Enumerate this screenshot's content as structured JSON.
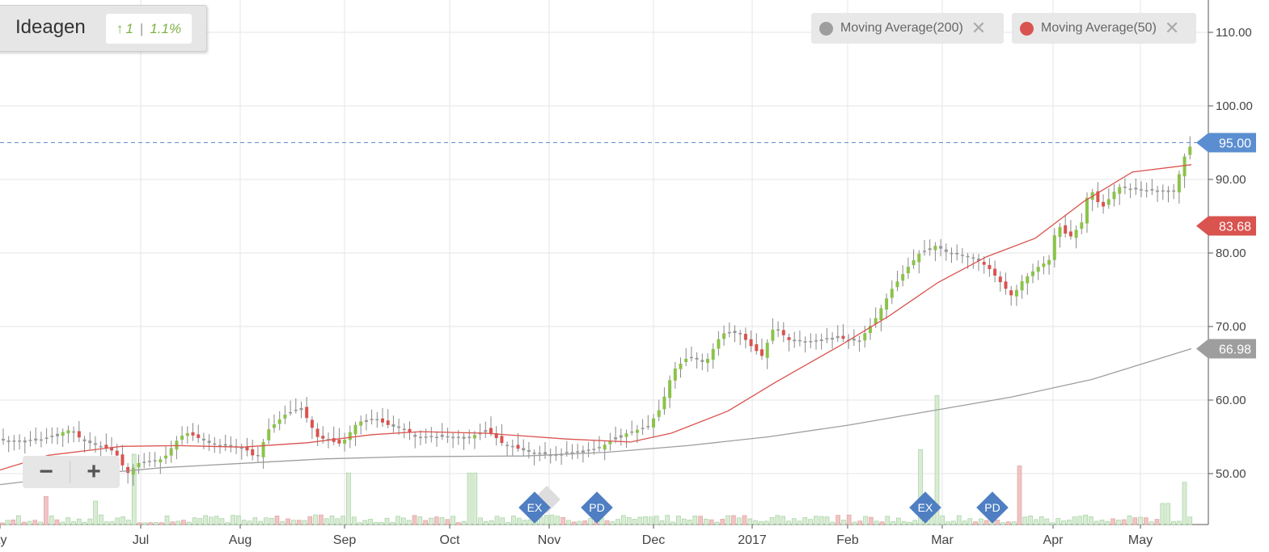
{
  "title": {
    "name": "Ideagen",
    "change_value": "1",
    "change_pct": "1.1%",
    "direction": "up"
  },
  "legend": [
    {
      "label": "Moving Average(200)",
      "color": "#9e9e9e"
    },
    {
      "label": "Moving Average(50)",
      "color": "#d9534f"
    }
  ],
  "zoom": {
    "minus": "−",
    "plus": "+"
  },
  "chart_data": {
    "type": "candlestick",
    "y_axis": {
      "min": 43,
      "max": 115,
      "ticks": [
        "50.00",
        "60.00",
        "70.00",
        "80.00",
        "90.00",
        "100.00",
        "110.00"
      ],
      "position": "right"
    },
    "x_axis": {
      "labels": [
        "ay",
        "Jul",
        "Aug",
        "Sep",
        "Oct",
        "Nov",
        "Dec",
        "2017",
        "Feb",
        "Mar",
        "Apr",
        "May"
      ]
    },
    "grid": true,
    "current_price": {
      "value": 95.0,
      "label": "95.00",
      "color": "#5b8ed0"
    },
    "series_labels": [
      {
        "name": "Moving Average(50)",
        "value": 83.68,
        "label": "83.68",
        "color": "#d9534f"
      },
      {
        "name": "Moving Average(200)",
        "value": 66.98,
        "label": "66.98",
        "color": "#9e9e9e"
      }
    ],
    "price_anchors": [
      [
        0,
        54.5
      ],
      [
        45,
        54.5
      ],
      [
        85,
        56
      ],
      [
        100,
        54.5
      ],
      [
        140,
        53
      ],
      [
        155,
        50
      ],
      [
        170,
        51.5
      ],
      [
        200,
        52
      ],
      [
        220,
        55
      ],
      [
        230,
        55.5
      ],
      [
        260,
        54
      ],
      [
        300,
        53.5
      ],
      [
        315,
        52
      ],
      [
        330,
        56
      ],
      [
        350,
        58
      ],
      [
        370,
        59
      ],
      [
        390,
        55
      ],
      [
        420,
        54
      ],
      [
        440,
        57
      ],
      [
        460,
        57.5
      ],
      [
        480,
        56.5
      ],
      [
        500,
        56
      ],
      [
        510,
        55
      ],
      [
        550,
        55
      ],
      [
        580,
        55
      ],
      [
        600,
        56
      ],
      [
        620,
        54
      ],
      [
        650,
        53
      ],
      [
        680,
        52.5
      ],
      [
        710,
        53
      ],
      [
        740,
        53.5
      ],
      [
        760,
        55
      ],
      [
        800,
        56.5
      ],
      [
        815,
        59
      ],
      [
        830,
        64
      ],
      [
        850,
        66
      ],
      [
        870,
        65
      ],
      [
        890,
        69
      ],
      [
        910,
        69.5
      ],
      [
        925,
        67.5
      ],
      [
        940,
        66
      ],
      [
        955,
        70
      ],
      [
        975,
        68
      ],
      [
        1000,
        68
      ],
      [
        1030,
        68.5
      ],
      [
        1060,
        68
      ],
      [
        1080,
        71
      ],
      [
        1100,
        75
      ],
      [
        1120,
        78
      ],
      [
        1135,
        80
      ],
      [
        1155,
        81
      ],
      [
        1170,
        80
      ],
      [
        1200,
        79.5
      ],
      [
        1220,
        78
      ],
      [
        1235,
        76
      ],
      [
        1250,
        74
      ],
      [
        1260,
        76
      ],
      [
        1280,
        78
      ],
      [
        1295,
        79
      ],
      [
        1305,
        84
      ],
      [
        1320,
        82
      ],
      [
        1335,
        84
      ],
      [
        1345,
        89
      ],
      [
        1360,
        86
      ],
      [
        1380,
        89
      ],
      [
        1410,
        88.5
      ],
      [
        1450,
        88.5
      ],
      [
        1462,
        93
      ],
      [
        1472,
        95
      ]
    ],
    "ma50": [
      [
        0,
        50.5
      ],
      [
        60,
        52.5
      ],
      [
        150,
        53.7
      ],
      [
        220,
        53.8
      ],
      [
        300,
        53.6
      ],
      [
        380,
        54.2
      ],
      [
        460,
        55.3
      ],
      [
        520,
        55.7
      ],
      [
        600,
        55.5
      ],
      [
        700,
        54.7
      ],
      [
        780,
        54.3
      ],
      [
        830,
        55.5
      ],
      [
        900,
        58.5
      ],
      [
        960,
        62.5
      ],
      [
        1040,
        67.5
      ],
      [
        1100,
        71.5
      ],
      [
        1160,
        76
      ],
      [
        1220,
        79.5
      ],
      [
        1280,
        82
      ],
      [
        1340,
        87
      ],
      [
        1400,
        91
      ],
      [
        1473,
        92
      ]
    ],
    "ma200": [
      [
        0,
        48.5
      ],
      [
        100,
        49.8
      ],
      [
        200,
        50.8
      ],
      [
        300,
        51.4
      ],
      [
        400,
        52.0
      ],
      [
        500,
        52.3
      ],
      [
        650,
        52.4
      ],
      [
        750,
        52.9
      ],
      [
        850,
        53.8
      ],
      [
        950,
        55.0
      ],
      [
        1050,
        56.6
      ],
      [
        1150,
        58.5
      ],
      [
        1250,
        60.4
      ],
      [
        1350,
        62.8
      ],
      [
        1473,
        66.98
      ]
    ],
    "events": [
      {
        "label": "EX",
        "at": "Nov"
      },
      {
        "label": "PD",
        "at": "Nov"
      },
      {
        "label": "EX",
        "at": "Mar"
      },
      {
        "label": "PD",
        "at": "Mar"
      }
    ],
    "volume": {
      "spikes": [
        [
          1155,
          0.55
        ],
        [
          1137,
          0.32
        ],
        [
          1260,
          0.25
        ],
        [
          165,
          0.3
        ],
        [
          430,
          0.22
        ],
        [
          582,
          0.22
        ],
        [
          1462,
          0.18
        ],
        [
          1438,
          0.09
        ],
        [
          115,
          0.1
        ],
        [
          54,
          0.12
        ]
      ]
    }
  }
}
